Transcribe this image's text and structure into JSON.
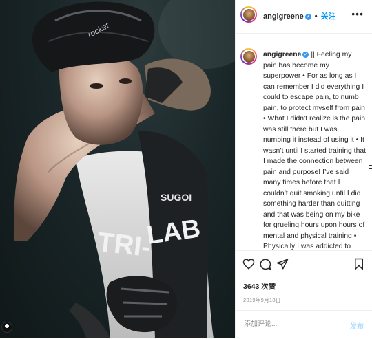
{
  "post": {
    "author": {
      "username": "angigreene",
      "verified": true,
      "follow_label": "关注",
      "separator": "•"
    },
    "photo": {
      "jersey_text_1": "TRI-",
      "jersey_text_2": "LAB",
      "jersey_brand": "SUGOI",
      "helmet_text": "rocket"
    },
    "caption": {
      "username": "angigreene",
      "text": "|| Feeling my pain has become my superpower • For as long as I can remember I did everything I could to escape pain, to numb pain, to protect myself from pain • What I didn’t realize is the pain was still there but I was numbing it instead of using it • It wasn’t until I started training that I made the connection between pain and purpose! I’ve said many times before that I couldn’t quit smoking until I did something harder than quitting and that was being on my bike for grueling hours upon hours of mental and physical training • Physically I was addicted to cigarettes, but emotionally I was addicted as well because it helped me stay in a dark victim place • It wasn’t until I got stronger mentally"
    },
    "stats": {
      "likes": "3643 次赞",
      "date": "2019年9月18日"
    },
    "comment": {
      "placeholder": "添加评论...",
      "post_label": "发布"
    }
  },
  "icons": [
    "heart-icon",
    "comment-icon",
    "share-icon",
    "bookmark-icon",
    "more-icon",
    "verified-icon",
    "user-tag-icon"
  ],
  "colors": {
    "accent": "#0095f6",
    "verified": "#3897f0",
    "post_disabled": "#b2dffc",
    "muted": "#8e8e8e",
    "text": "#262626"
  }
}
